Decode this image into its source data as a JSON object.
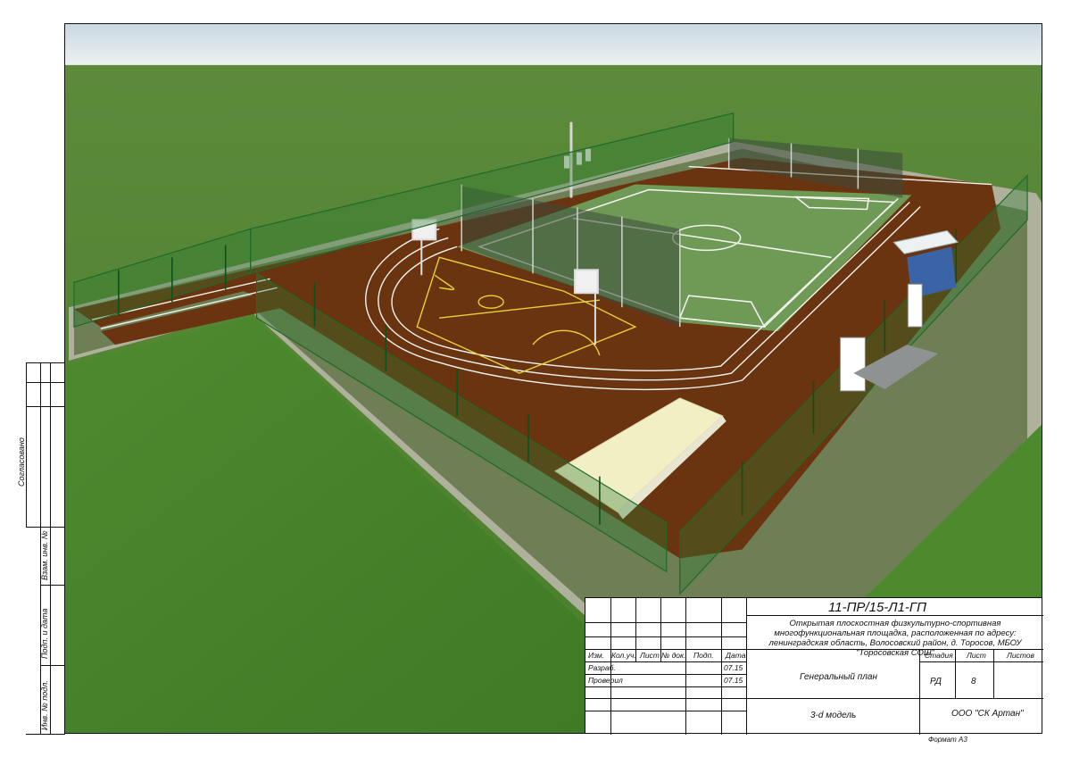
{
  "side_stamp": {
    "agreed": "Согласовано",
    "inv_ref": "Взам. инв. №",
    "sign_date": "Подп. и дата",
    "inv_orig": "Инв. № подл."
  },
  "title_block": {
    "doc_code": "11-ПР/15-Л1-ГП",
    "description": "Открытая плоскостная физкультурно-спортивная многофункциональная площадка, расположенная по адресу: ленинградская область, Волосовский район, д. Торосов, МБОУ \"Торосовская СОШ\"",
    "headers": {
      "izm": "Изм.",
      "kol_uch": "Кол.уч.",
      "list": "Лист",
      "doc_no": "№ док.",
      "podp": "Подп.",
      "data": "Дата"
    },
    "rows": [
      {
        "role": "Разраб.",
        "date": "07.15"
      },
      {
        "role": "Проверил",
        "date": "07.15"
      }
    ],
    "sheet_title": "Генеральный план",
    "stage_label": "Стадия",
    "sheet_label": "Лист",
    "sheets_label": "Листов",
    "stage": "РД",
    "sheet_no": "8",
    "sheets_total": "",
    "drawing_name": "3-d модель",
    "company": "ООО \"СК Артан\""
  },
  "format_label": "Формат А3",
  "colors": {
    "grass": "#4f8a2e",
    "track": "#6b3410",
    "field": "#6f9a56",
    "fence": "#1f6a2a",
    "sky": "#dfe8ec"
  }
}
